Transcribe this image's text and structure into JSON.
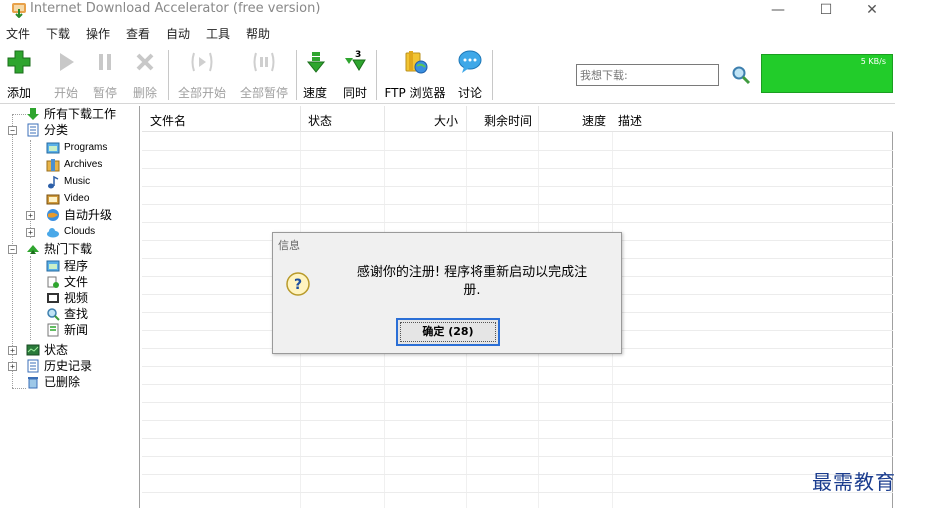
{
  "window": {
    "title": "Internet Download Accelerator (free version)",
    "minimize": "—",
    "maximize": "☐",
    "close": "✕"
  },
  "menu": [
    "文件",
    "下载",
    "操作",
    "查看",
    "自动",
    "工具",
    "帮助"
  ],
  "toolbar": {
    "add": "添加",
    "start": "开始",
    "pause": "暂停",
    "delete": "删除",
    "start_all": "全部开始",
    "pause_all": "全部暂停",
    "speed": "速度",
    "simultaneous": "同时",
    "simultaneous_badge": "3",
    "ftp_browser": "FTP 浏览器",
    "discuss": "讨论",
    "search_placeholder": "我想下载:",
    "speed_readout": "5 KB/s"
  },
  "tree": {
    "all_downloads": "所有下载工作",
    "categories": "分类",
    "programs": "Programs",
    "archives": "Archives",
    "music": "Music",
    "video": "Video",
    "auto_upgrade": "自动升级",
    "clouds": "Clouds",
    "hot_downloads": "热门下载",
    "hot_programs": "程序",
    "hot_files": "文件",
    "hot_video": "视频",
    "hot_search": "查找",
    "hot_news": "新闻",
    "status": "状态",
    "history": "历史记录",
    "deleted": "已删除"
  },
  "list": {
    "columns": {
      "filename": "文件名",
      "status": "状态",
      "size": "大小",
      "time_left": "剩余时间",
      "speed": "速度",
      "description": "描述"
    }
  },
  "dialog": {
    "title": "信息",
    "message_line1": "感谢你的注册! 程序将重新启动以完成注",
    "message_line2": "册.",
    "ok_label": "确定 (28)"
  },
  "watermark": "最需教育",
  "colors": {
    "speed_graph": "#22cc2a",
    "focus_border": "#2b6fd6"
  }
}
